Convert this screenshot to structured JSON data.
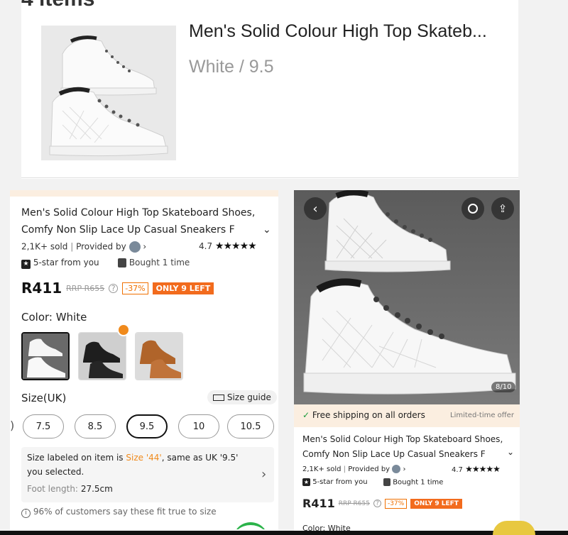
{
  "top": {
    "heading": "4 items",
    "title": "Men's Solid Colour High Top Skateb...",
    "variant": "White / 9.5"
  },
  "product": {
    "title_line1": "Men's Solid Colour High Top Skateboard Shoes,",
    "title_line2": "Comfy Non Slip Lace Up Casual Sneakers F",
    "sold": "2,1K+ sold",
    "provided_by": "Provided by",
    "rating": "4.7",
    "stars": "★★★★★",
    "five_star_label": "5-star from you",
    "bought_label": "Bought 1 time",
    "price": "R411",
    "rrp": "RRP R655",
    "discount": "-37%",
    "stock_badge": "ONLY 9 LEFT"
  },
  "color": {
    "label": "Color: White",
    "options": [
      "White",
      "Black",
      "Brown"
    ]
  },
  "size": {
    "label": "Size(UK)",
    "guide": "Size guide",
    "options": [
      "7.5",
      "8.5",
      "9.5",
      "10",
      "10.5"
    ],
    "selected": "9.5",
    "info_prefix": "Size labeled on item is ",
    "info_highlight": "Size '44'",
    "info_suffix": ", same as UK '9.5'",
    "info_line2": "you selected.",
    "foot_label": "Foot length:",
    "foot_value": "27.5cm",
    "fit_note": "96% of customers say these fit true to size"
  },
  "right": {
    "counter": "8/10",
    "shipping": "Free shipping on all orders",
    "limited": "Limited-time offer",
    "title_line1": "Men's Solid Colour High Top Skateboard Shoes,",
    "title_line2": "Comfy Non Slip Lace Up Casual Sneakers F",
    "sold": "2,1K+ sold",
    "provided_by": "Provided by",
    "rating": "4.7",
    "stars": "★★★★★",
    "five_star_label": "5-star from you",
    "bought_label": "Bought 1 time",
    "price": "R411",
    "rrp": "RRP R655",
    "discount": "-37%",
    "stock_badge": "ONLY 9 LEFT",
    "color_cut": "Color: White"
  },
  "colors": {
    "accent_orange": "#f26b1d",
    "highlight_orange": "#f08a1c",
    "strip": "#fbeee0",
    "green_check": "#1a9a3a"
  }
}
